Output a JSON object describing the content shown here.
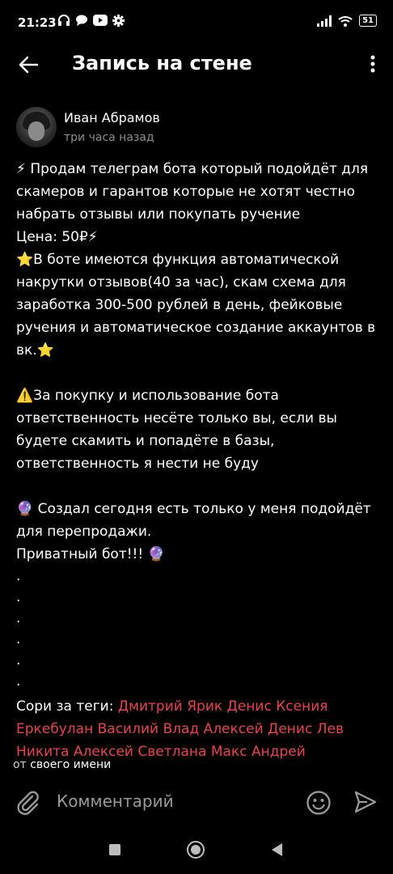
{
  "status": {
    "time": "21:23",
    "battery": "51"
  },
  "header": {
    "title": "Запись на стене"
  },
  "author": {
    "name": "Иван Абрамов",
    "time": "три часа назад"
  },
  "post": {
    "p1": "⚡ Продам телеграм бота который подойдёт для скамеров и гарантов которые не хотят честно набрать отзывы или покупать ручение",
    "price": "Цена: 50₽⚡",
    "p2": "⭐В боте имеются функция автоматической накрутки отзывов(40 за час), скам схема для заработка 300-500 рублей в день, фейковые ручения и автоматическое создание аккаунтов в вк.⭐",
    "p3": "⚠️За покупку и использование бота ответственность несёте только вы, если вы будете скамить и попадёте в базы, ответственность я нести не буду",
    "p4": "🔮 Создал сегодня есть только у меня подойдёт для перепродажи.",
    "p5": "Приватный бот!!! 🔮",
    "dots": [
      ".",
      ".",
      ".",
      ".",
      ".",
      "."
    ],
    "tags_label": "Сори за теги: ",
    "tags": [
      "Дмитрий",
      "Ярик",
      "Денис",
      "Ксения",
      "Еркебулан",
      "Василий",
      "Влад",
      "Алексей",
      "Денис",
      "Лев",
      "Никита",
      "Алексей",
      "Светлана",
      "Макс",
      "Андрей"
    ]
  },
  "footer_note": {
    "prefix": "от",
    "text": "своего имени"
  },
  "comment": {
    "placeholder": "Комментарий"
  },
  "colors": {
    "tag": "#e8434b",
    "muted": "#8d8d8d",
    "background": "#000000"
  },
  "icons": [
    "headphones-icon",
    "chat-icon",
    "youtube-icon",
    "gear-icon",
    "signal-icon",
    "wifi-icon",
    "battery-icon",
    "back-arrow-icon",
    "more-vert-icon",
    "paperclip-icon",
    "smile-icon",
    "send-icon"
  ]
}
